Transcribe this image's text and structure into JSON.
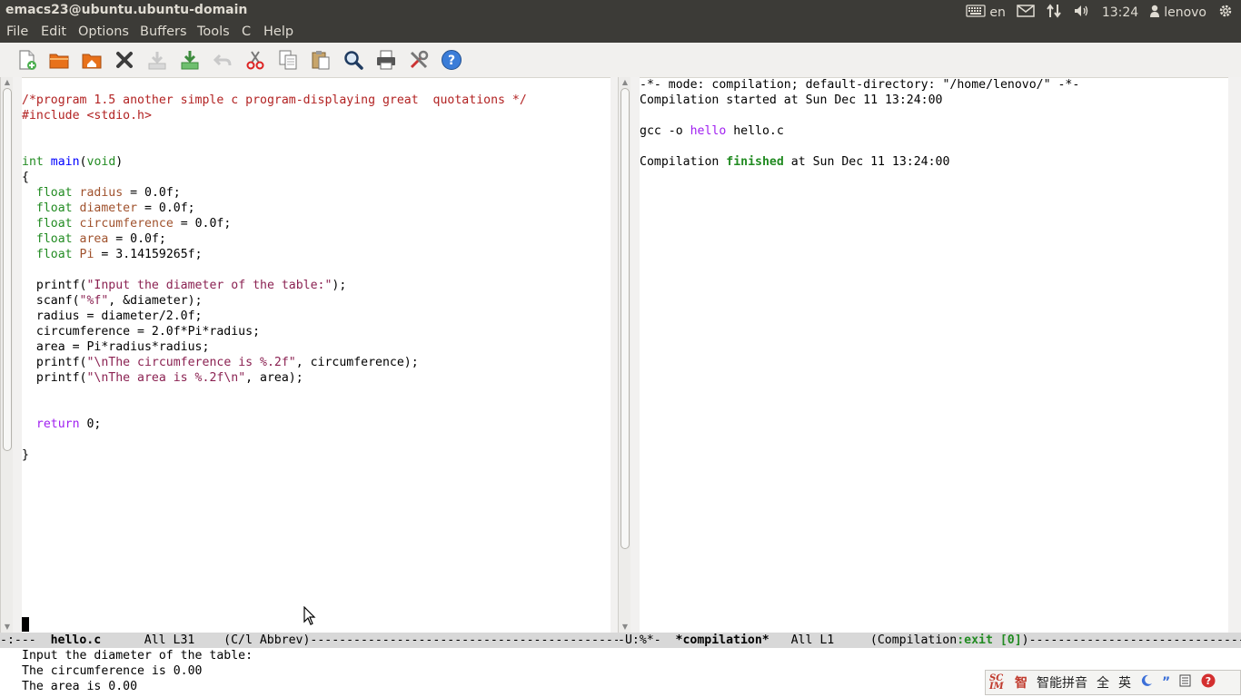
{
  "top_panel": {
    "window_title": "emacs23@ubuntu.ubuntu-domain",
    "keyboard_layout": "en",
    "clock": "13:24",
    "user": "lenovo"
  },
  "menubar": {
    "items": [
      "File",
      "Edit",
      "Options",
      "Buffers",
      "Tools",
      "C",
      "Help"
    ]
  },
  "toolbar": {
    "icons": [
      "new-file-icon",
      "open-file-icon",
      "open-directory-icon",
      "close-buffer-icon",
      "save-icon",
      "save-as-icon",
      "undo-icon",
      "cut-icon",
      "copy-icon",
      "paste-icon",
      "search-icon",
      "print-icon",
      "preferences-icon",
      "help-icon"
    ]
  },
  "left_buffer": {
    "lines": [
      {
        "parts": [
          {
            "t": "/*program 1.5 another simple c program-displaying great  quotations */",
            "c": "c-comment"
          }
        ]
      },
      {
        "parts": [
          {
            "t": "#include <stdio.h>",
            "c": "c-pre"
          }
        ]
      },
      {
        "parts": [
          {
            "t": "",
            "c": ""
          }
        ]
      },
      {
        "parts": [
          {
            "t": "",
            "c": ""
          }
        ]
      },
      {
        "parts": [
          {
            "t": "int",
            "c": "c-type"
          },
          {
            "t": " ",
            "c": ""
          },
          {
            "t": "main",
            "c": "c-func"
          },
          {
            "t": "(",
            "c": ""
          },
          {
            "t": "void",
            "c": "c-type"
          },
          {
            "t": ")",
            "c": ""
          }
        ]
      },
      {
        "parts": [
          {
            "t": "{",
            "c": ""
          }
        ]
      },
      {
        "parts": [
          {
            "t": "  ",
            "c": ""
          },
          {
            "t": "float",
            "c": "c-type"
          },
          {
            "t": " ",
            "c": ""
          },
          {
            "t": "radius",
            "c": "c-var"
          },
          {
            "t": " = 0.0f;",
            "c": ""
          }
        ]
      },
      {
        "parts": [
          {
            "t": "  ",
            "c": ""
          },
          {
            "t": "float",
            "c": "c-type"
          },
          {
            "t": " ",
            "c": ""
          },
          {
            "t": "diameter",
            "c": "c-var"
          },
          {
            "t": " = 0.0f;",
            "c": ""
          }
        ]
      },
      {
        "parts": [
          {
            "t": "  ",
            "c": ""
          },
          {
            "t": "float",
            "c": "c-type"
          },
          {
            "t": " ",
            "c": ""
          },
          {
            "t": "circumference",
            "c": "c-var"
          },
          {
            "t": " = 0.0f;",
            "c": ""
          }
        ]
      },
      {
        "parts": [
          {
            "t": "  ",
            "c": ""
          },
          {
            "t": "float",
            "c": "c-type"
          },
          {
            "t": " ",
            "c": ""
          },
          {
            "t": "area",
            "c": "c-var"
          },
          {
            "t": " = 0.0f;",
            "c": ""
          }
        ]
      },
      {
        "parts": [
          {
            "t": "  ",
            "c": ""
          },
          {
            "t": "float",
            "c": "c-type"
          },
          {
            "t": " ",
            "c": ""
          },
          {
            "t": "Pi",
            "c": "c-var"
          },
          {
            "t": " = 3.14159265f;",
            "c": ""
          }
        ]
      },
      {
        "parts": [
          {
            "t": "",
            "c": ""
          }
        ]
      },
      {
        "parts": [
          {
            "t": "  printf(",
            "c": ""
          },
          {
            "t": "\"Input the diameter of the table:\"",
            "c": "c-str"
          },
          {
            "t": ");",
            "c": ""
          }
        ]
      },
      {
        "parts": [
          {
            "t": "  scanf(",
            "c": ""
          },
          {
            "t": "\"%f\"",
            "c": "c-str"
          },
          {
            "t": ", &diameter);",
            "c": ""
          }
        ]
      },
      {
        "parts": [
          {
            "t": "  radius = diameter/2.0f;",
            "c": ""
          }
        ]
      },
      {
        "parts": [
          {
            "t": "  circumference = 2.0f*Pi*radius;",
            "c": ""
          }
        ]
      },
      {
        "parts": [
          {
            "t": "  area = Pi*radius*radius;",
            "c": ""
          }
        ]
      },
      {
        "parts": [
          {
            "t": "  printf(",
            "c": ""
          },
          {
            "t": "\"\\nThe circumference is %.2f\"",
            "c": "c-str"
          },
          {
            "t": ", circumference);",
            "c": ""
          }
        ]
      },
      {
        "parts": [
          {
            "t": "  printf(",
            "c": ""
          },
          {
            "t": "\"\\nThe area is %.2f\\n\"",
            "c": "c-str"
          },
          {
            "t": ", area);",
            "c": ""
          }
        ]
      },
      {
        "parts": [
          {
            "t": "",
            "c": ""
          }
        ]
      },
      {
        "parts": [
          {
            "t": "",
            "c": ""
          }
        ]
      },
      {
        "parts": [
          {
            "t": "  ",
            "c": ""
          },
          {
            "t": "return",
            "c": "c-kw"
          },
          {
            "t": " 0;",
            "c": ""
          }
        ]
      },
      {
        "parts": [
          {
            "t": "",
            "c": ""
          }
        ]
      },
      {
        "parts": [
          {
            "t": "}",
            "c": ""
          }
        ]
      }
    ]
  },
  "right_buffer": {
    "lines": [
      {
        "parts": [
          {
            "t": "-*- mode: compilation; default-directory: \"/home/lenovo/\" -*-",
            "c": ""
          }
        ]
      },
      {
        "parts": [
          {
            "t": "Compilation started at Sun Dec 11 13:24:00",
            "c": ""
          }
        ]
      },
      {
        "parts": [
          {
            "t": "",
            "c": ""
          }
        ]
      },
      {
        "parts": [
          {
            "t": "gcc -o ",
            "c": ""
          },
          {
            "t": "hello",
            "c": "c-purple"
          },
          {
            "t": " hello.c",
            "c": ""
          }
        ]
      },
      {
        "parts": [
          {
            "t": "",
            "c": ""
          }
        ]
      },
      {
        "parts": [
          {
            "t": "Compilation ",
            "c": ""
          },
          {
            "t": "finished",
            "c": "c-green"
          },
          {
            "t": " at Sun Dec 11 13:24:00",
            "c": ""
          }
        ]
      }
    ]
  },
  "left_modeline": {
    "status": "-:---  ",
    "buffer_name": "hello.c",
    "position": "      All L31    (C/l Abbrev)-----------------------------------------------------------------------------------------"
  },
  "right_modeline": {
    "status": "-U:%*-  ",
    "buffer_name": "*compilation*",
    "position": "   All L1     (Compilation",
    "exit_status": ":exit [0]",
    "tail": ")----------------------------------------------------------------"
  },
  "echo_area": {
    "lines": [
      "Input the diameter of the table:",
      "The circumference is 0.00",
      "The area is 0.00"
    ]
  },
  "ime_bar": {
    "logo": "SC IM",
    "mode_icon": "智",
    "input_method": "智能拼音",
    "width_mode": "全",
    "language": "英"
  },
  "colors": {
    "panel_bg": "#3c3b37",
    "panel_text": "#dfdbd2",
    "toolbar_bg": "#f1f0ee",
    "modeline_bg": "#d8d8d8",
    "comment": "#b22222",
    "type": "#228b22",
    "function": "#0000ff",
    "variable": "#a0522d",
    "string": "#8b2252",
    "keyword": "#a020f0"
  }
}
